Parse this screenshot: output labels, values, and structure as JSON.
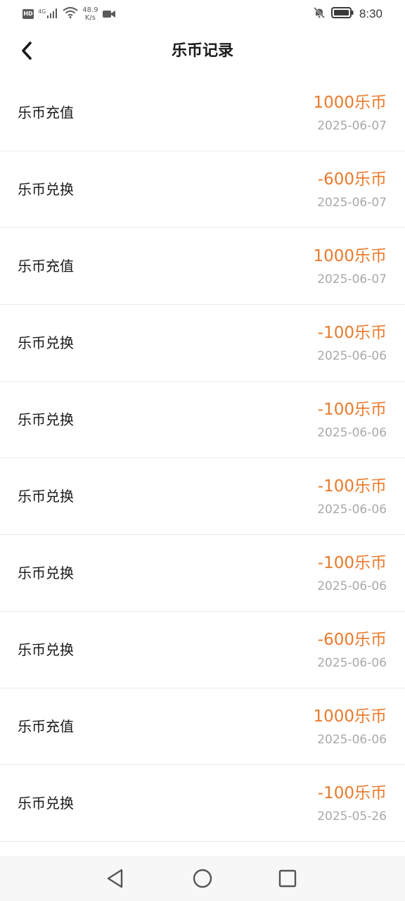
{
  "status_bar": {
    "hd": "HD",
    "network": "4G",
    "speed_value": "48.9",
    "speed_unit": "K/s",
    "time": "8:30"
  },
  "header": {
    "title": "乐币记录"
  },
  "records": [
    {
      "type": "乐币充值",
      "amount": "1000乐币",
      "date": "2025-06-07"
    },
    {
      "type": "乐币兑换",
      "amount": "-600乐币",
      "date": "2025-06-07"
    },
    {
      "type": "乐币充值",
      "amount": "1000乐币",
      "date": "2025-06-07"
    },
    {
      "type": "乐币兑换",
      "amount": "-100乐币",
      "date": "2025-06-06"
    },
    {
      "type": "乐币兑换",
      "amount": "-100乐币",
      "date": "2025-06-06"
    },
    {
      "type": "乐币兑换",
      "amount": "-100乐币",
      "date": "2025-06-06"
    },
    {
      "type": "乐币兑换",
      "amount": "-100乐币",
      "date": "2025-06-06"
    },
    {
      "type": "乐币兑换",
      "amount": "-600乐币",
      "date": "2025-06-06"
    },
    {
      "type": "乐币充值",
      "amount": "1000乐币",
      "date": "2025-06-06"
    },
    {
      "type": "乐币兑换",
      "amount": "-100乐币",
      "date": "2025-05-26"
    }
  ],
  "colors": {
    "amount": "#ea7a2c",
    "date": "#a9a9a9",
    "divider": "#ececec"
  },
  "icons": {
    "back": "chevron-left-icon",
    "nav_back": "triangle-back-icon",
    "nav_home": "circle-home-icon",
    "nav_recent": "square-recent-icon"
  }
}
